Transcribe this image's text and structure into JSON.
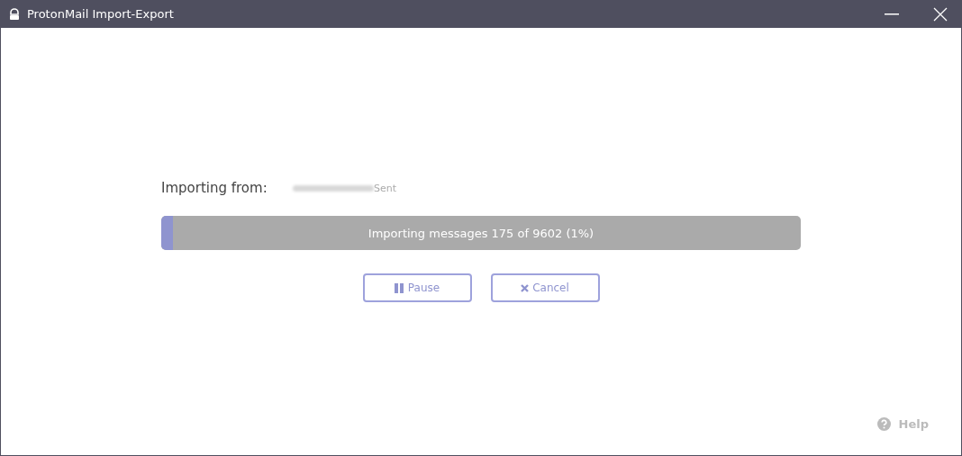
{
  "window": {
    "title": "ProtonMail Import-Export"
  },
  "source": {
    "label": "Importing from:",
    "folder": "Sent"
  },
  "progress": {
    "level": 0.018,
    "text": "Importing messages 175 of 9602 (1%)"
  },
  "buttons": [
    {
      "kind": "pause",
      "label": "Pause"
    },
    {
      "kind": "cancel",
      "label": "Cancel"
    }
  ],
  "help": {
    "label": "Help"
  }
}
